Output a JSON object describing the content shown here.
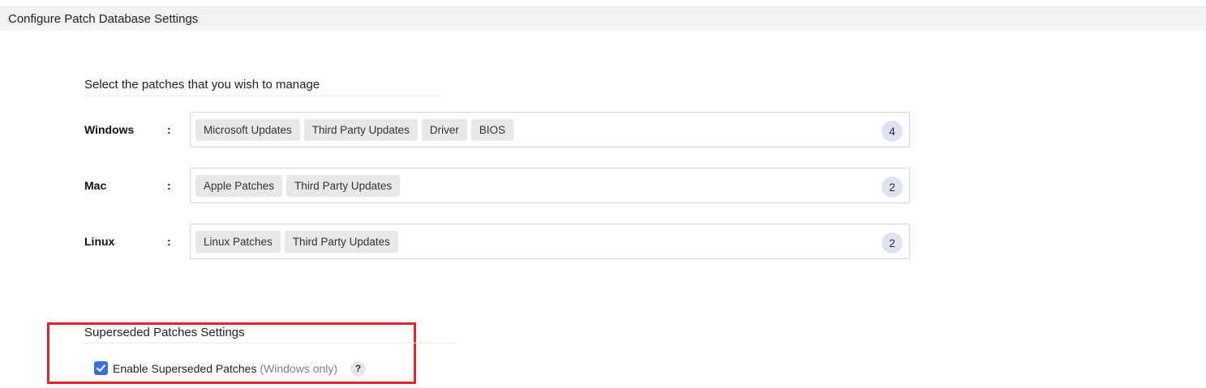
{
  "header": {
    "title": "Configure Patch Database Settings"
  },
  "patches": {
    "title": "Select the patches that you wish to manage",
    "separator": ":",
    "rows": [
      {
        "os": "Windows",
        "chips": [
          "Microsoft Updates",
          "Third Party Updates",
          "Driver",
          "BIOS"
        ],
        "count": "4"
      },
      {
        "os": "Mac",
        "chips": [
          "Apple Patches",
          "Third Party Updates"
        ],
        "count": "2"
      },
      {
        "os": "Linux",
        "chips": [
          "Linux Patches",
          "Third Party Updates"
        ],
        "count": "2"
      }
    ]
  },
  "superseded": {
    "title": "Superseded Patches Settings",
    "checkbox_label": "Enable Superseded Patches",
    "checkbox_note": "(Windows only)",
    "checked": true,
    "help": "?"
  },
  "colors": {
    "accent": "#3b6fd8",
    "highlight": "#e0262d",
    "badge": "#dde3f3"
  },
  "icons": {
    "checkbox": "check-icon",
    "help": "question-icon"
  }
}
